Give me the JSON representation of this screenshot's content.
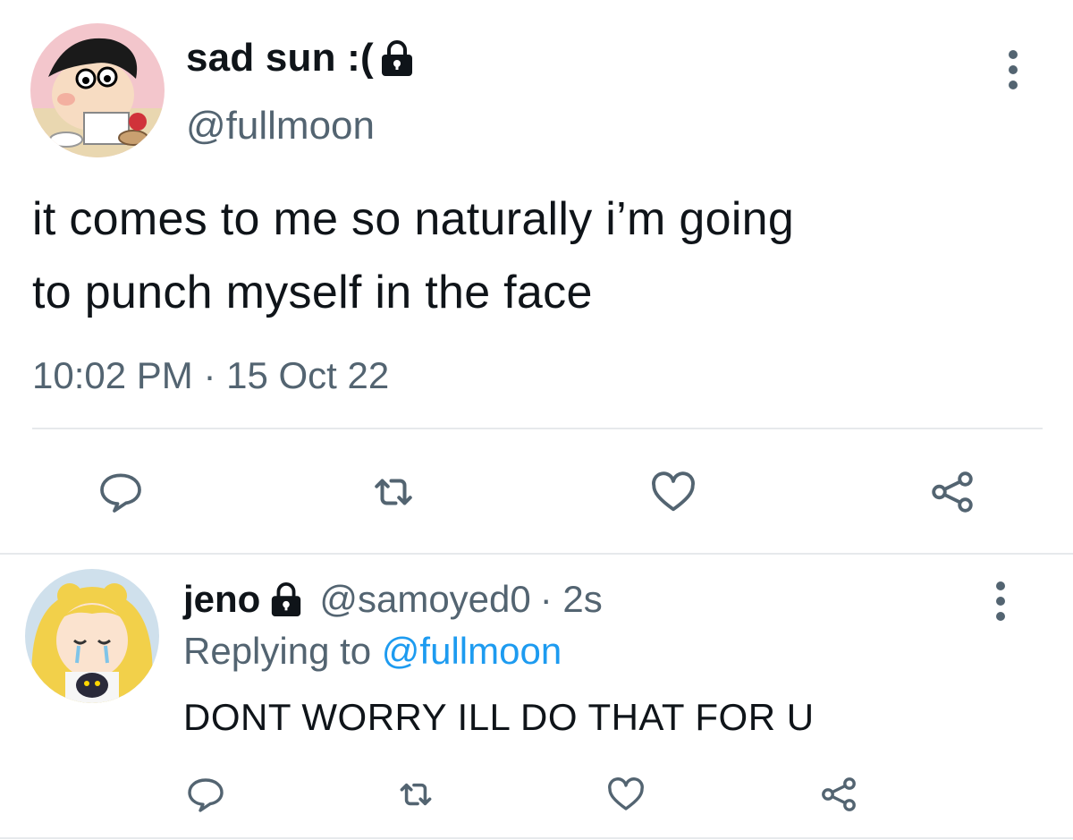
{
  "tweet": {
    "author_name": "sad sun :(",
    "author_handle": "@fullmoon",
    "text_line1": "it comes to me so naturally i’m going",
    "text_line2": "to punch myself in the face",
    "timestamp": "10:02 PM · 15 Oct 22",
    "avatar_icon": "cartoon-boy-avatar",
    "lock_icon": "lock-icon",
    "actions": [
      "reply-icon",
      "retweet-icon",
      "like-icon",
      "share-icon"
    ]
  },
  "reply": {
    "author_name": "jeno",
    "author_handle": "@samoyed0",
    "time": "· 2s",
    "replying_prefix": "Replying to",
    "replying_handle": "@fullmoon",
    "text": "DONT WORRY ILL DO THAT FOR U",
    "avatar_icon": "anime-girl-avatar",
    "actions": [
      "reply-icon",
      "retweet-icon",
      "like-icon",
      "share-icon"
    ]
  },
  "colors": {
    "text": "#0f1419",
    "secondary": "#536471",
    "link": "#1d9bf0",
    "divider": "#e6e9ec"
  }
}
